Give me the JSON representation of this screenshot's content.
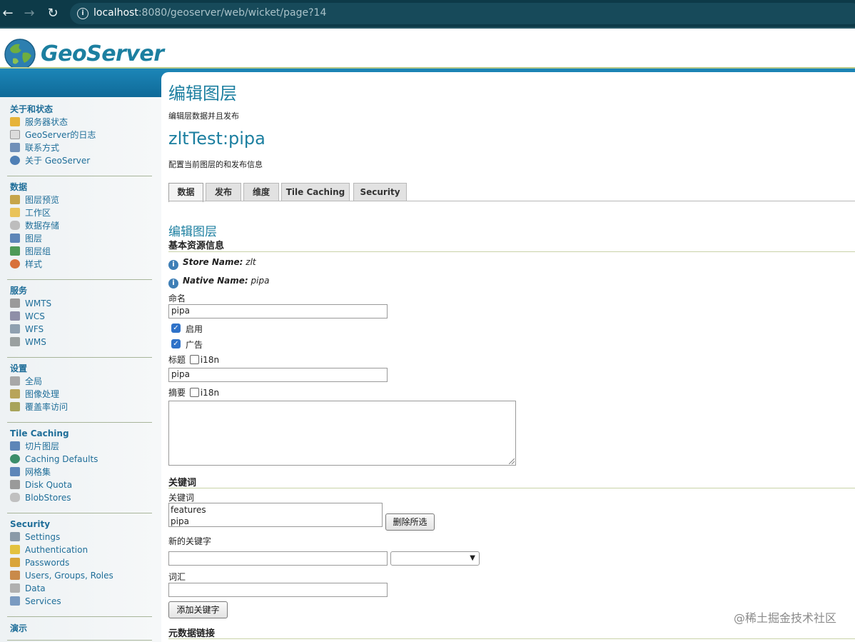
{
  "browser": {
    "url_host": "localhost",
    "url_rest": ":8080/geoserver/web/wicket/page?14"
  },
  "brand": {
    "name": "GeoServer"
  },
  "sidebar": {
    "sections": [
      {
        "title": "关于和状态",
        "items": [
          {
            "label": "服务器状态",
            "icon": "warning-icon",
            "color": "#e6b33a"
          },
          {
            "label": "GeoServer的日志",
            "icon": "document-icon",
            "color": "#dcdcdc"
          },
          {
            "label": "联系方式",
            "icon": "contact-card-icon",
            "color": "#6f8fb8"
          },
          {
            "label": "关于 GeoServer",
            "icon": "info-icon",
            "color": "#4f7fb5"
          }
        ]
      },
      {
        "title": "数据",
        "items": [
          {
            "label": "图层预览",
            "icon": "map-preview-icon",
            "color": "#c6a54a"
          },
          {
            "label": "工作区",
            "icon": "folder-icon",
            "color": "#e9c35a"
          },
          {
            "label": "数据存储",
            "icon": "database-icon",
            "color": "#bdbdbd"
          },
          {
            "label": "图层",
            "icon": "layer-icon",
            "color": "#5d86b8"
          },
          {
            "label": "图层组",
            "icon": "layer-group-icon",
            "color": "#4e9a57"
          },
          {
            "label": "样式",
            "icon": "palette-icon",
            "color": "#d8713a"
          }
        ]
      },
      {
        "title": "服务",
        "items": [
          {
            "label": "WMTS",
            "icon": "service-icon",
            "color": "#9a9a9a"
          },
          {
            "label": "WCS",
            "icon": "service-icon",
            "color": "#8f8fa8"
          },
          {
            "label": "WFS",
            "icon": "service-icon",
            "color": "#8fa0b0"
          },
          {
            "label": "WMS",
            "icon": "service-icon",
            "color": "#9aa0a0"
          }
        ]
      },
      {
        "title": "设置",
        "items": [
          {
            "label": "全局",
            "icon": "server-icon",
            "color": "#a8a8a8"
          },
          {
            "label": "图像处理",
            "icon": "image-icon",
            "color": "#b8a45a"
          },
          {
            "label": "覆盖率访问",
            "icon": "coverage-icon",
            "color": "#a8a45a"
          }
        ]
      },
      {
        "title": "Tile Caching",
        "items": [
          {
            "label": "切片图层",
            "icon": "tile-layer-icon",
            "color": "#5d86b8"
          },
          {
            "label": "Caching Defaults",
            "icon": "globe-icon",
            "color": "#3b8d6a"
          },
          {
            "label": "网格集",
            "icon": "grid-icon",
            "color": "#5d86b8"
          },
          {
            "label": "Disk Quota",
            "icon": "disk-icon",
            "color": "#9a9a9a"
          },
          {
            "label": "BlobStores",
            "icon": "blobstore-icon",
            "color": "#c0c0c0"
          }
        ]
      },
      {
        "title": "Security",
        "items": [
          {
            "label": "Settings",
            "icon": "wrench-icon",
            "color": "#8a9aa8"
          },
          {
            "label": "Authentication",
            "icon": "shield-icon",
            "color": "#e3c240"
          },
          {
            "label": "Passwords",
            "icon": "lock-icon",
            "color": "#d9a53a"
          },
          {
            "label": "Users, Groups, Roles",
            "icon": "users-icon",
            "color": "#c98a4a"
          },
          {
            "label": "Data",
            "icon": "data-lock-icon",
            "color": "#b0b0b0"
          },
          {
            "label": "Services",
            "icon": "services-edit-icon",
            "color": "#7a9ac0"
          }
        ]
      },
      {
        "title": "演示",
        "items": []
      }
    ]
  },
  "main": {
    "page_title": "编辑图层",
    "page_subtitle": "编辑层数据并且发布",
    "layer_name": "zltTest:pipa",
    "layer_desc": "配置当前图层的和发布信息",
    "tabs": [
      {
        "label": "数据",
        "active": true
      },
      {
        "label": "发布",
        "active": false
      },
      {
        "label": "维度",
        "active": false
      },
      {
        "label": "Tile Caching",
        "active": false
      },
      {
        "label": "Security",
        "active": false
      }
    ],
    "section_title": "编辑图层",
    "basic_heading": "基本资源信息",
    "store_label": "Store Name:",
    "store_value": "zlt",
    "native_label": "Native Name:",
    "native_value": "pipa",
    "name_label": "命名",
    "name_value": "pipa",
    "enabled_label": "启用",
    "advertised_label": "广告",
    "title_label": "标题",
    "i18n_label": "i18n",
    "title_value": "pipa",
    "abstract_label": "摘要",
    "abstract_value": "",
    "keywords_heading": "关键词",
    "keywords_label": "关键词",
    "keywords": [
      "features",
      "pipa"
    ],
    "remove_selected": "删除所选",
    "new_keyword_label": "新的关键字",
    "new_keyword_value": "",
    "vocabulary_label": "词汇",
    "vocabulary_value": "",
    "add_keyword": "添加关键字",
    "metadata_heading": "元数据链接"
  },
  "watermark": "@稀土掘金技术社区"
}
